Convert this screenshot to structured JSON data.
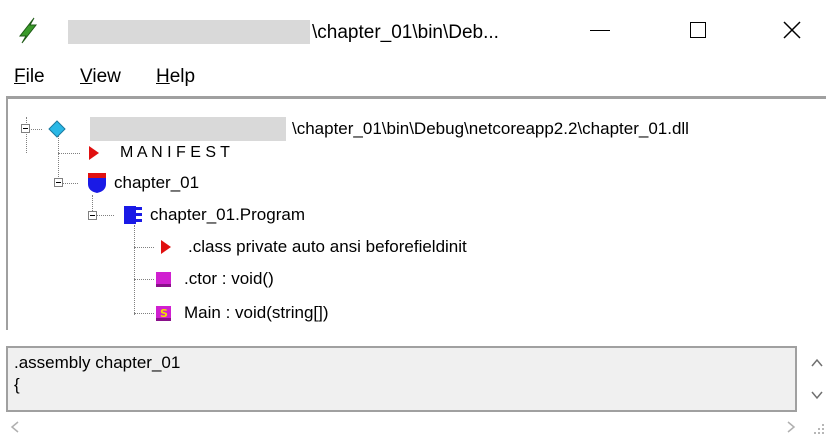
{
  "window": {
    "title_suffix": "\\chapter_01\\bin\\Deb...",
    "controls": {
      "minimize": "—",
      "maximize": "☐",
      "close": "✕"
    }
  },
  "menu": [
    {
      "key": "F",
      "rest": "ile"
    },
    {
      "key": "V",
      "rest": "iew"
    },
    {
      "key": "H",
      "rest": "elp"
    }
  ],
  "tree": {
    "root_path": "\\chapter_01\\bin\\Debug\\netcoreapp2.2\\chapter_01.dll",
    "manifest": "M A N I F E S T",
    "namespace": "chapter_01",
    "class": "chapter_01.Program",
    "members": [
      ".class private auto ansi beforefieldinit",
      ".ctor : void()",
      "Main : void(string[])"
    ]
  },
  "il_text": {
    "line1": ".assembly chapter_01",
    "line2": "{"
  },
  "icons": {
    "app": "lightning-icon",
    "assembly": "diamond-icon",
    "manifest": "red-triangle-icon",
    "namespace": "shield-icon",
    "class": "class-icon",
    "method": "method-icon",
    "static_method": "static-method-icon"
  },
  "colors": {
    "diamond": "#2ab8e6",
    "red_marker": "#e01010",
    "blue_node": "#1a1ae6",
    "magenta_node": "#d020d0",
    "redaction": "#d9d9d9"
  }
}
